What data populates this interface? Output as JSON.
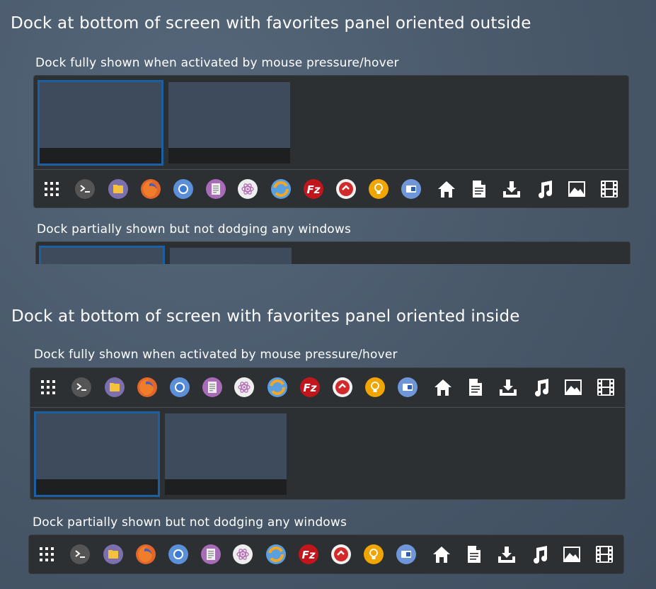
{
  "sections": {
    "outside": {
      "title": "Dock at bottom of screen with favorites panel oriented outside",
      "full_label": "Dock fully shown when activated by mouse pressure/hover",
      "partial_label": "Dock partially shown but not dodging any windows"
    },
    "inside": {
      "title": "Dock at bottom of screen with favorites panel oriented inside",
      "full_label": "Dock fully shown when activated by mouse pressure/hover",
      "partial_label": "Dock partially shown but not dodging any windows"
    }
  },
  "dock_icons": [
    {
      "name": "app-grid-icon",
      "color": "#ffffff"
    },
    {
      "name": "terminal-icon",
      "color": "#555555"
    },
    {
      "name": "files-icon",
      "color": "#7b6fae"
    },
    {
      "name": "firefox-icon",
      "color": "#e0662c"
    },
    {
      "name": "chromium-icon",
      "color": "#5b8fd8"
    },
    {
      "name": "text-editor-icon",
      "color": "#a86bb8"
    },
    {
      "name": "atom-icon",
      "color": "#eeeeee"
    },
    {
      "name": "blender-icon",
      "color": "#5aa0e0"
    },
    {
      "name": "filezilla-icon",
      "color": "#c1161c"
    },
    {
      "name": "recorder-icon",
      "color": "#d22a2a"
    },
    {
      "name": "idea-icon",
      "color": "#f0a500"
    },
    {
      "name": "settings-app-icon",
      "color": "#6e96d8"
    },
    {
      "name": "home-folder-icon",
      "color": "#ffffff"
    },
    {
      "name": "documents-folder-icon",
      "color": "#ffffff"
    },
    {
      "name": "downloads-folder-icon",
      "color": "#ffffff"
    },
    {
      "name": "music-folder-icon",
      "color": "#ffffff"
    },
    {
      "name": "pictures-folder-icon",
      "color": "#ffffff"
    },
    {
      "name": "videos-folder-icon",
      "color": "#ffffff"
    }
  ]
}
